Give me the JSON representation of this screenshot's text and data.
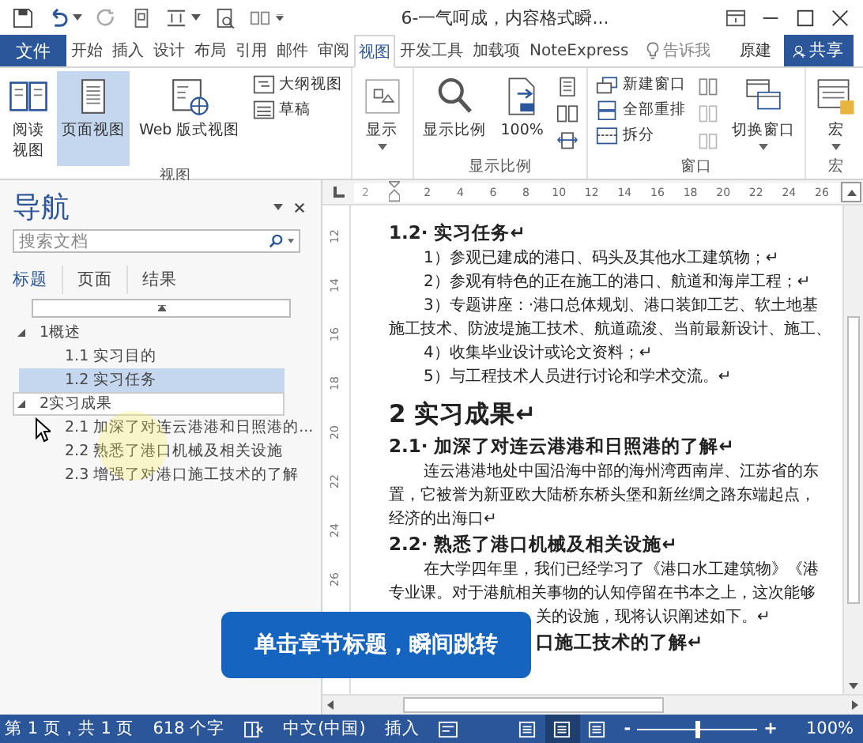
{
  "title_bar": {
    "title": "6-一气呵成，内容格式瞬..."
  },
  "ribbon_tabs": [
    {
      "label": "文件",
      "kind": "file"
    },
    {
      "label": "开始",
      "kind": "tab",
      "selected": false
    },
    {
      "label": "插入",
      "kind": "tab",
      "selected": false
    },
    {
      "label": "设计",
      "kind": "tab",
      "selected": false
    },
    {
      "label": "布局",
      "kind": "tab",
      "selected": false
    },
    {
      "label": "引用",
      "kind": "tab",
      "selected": false
    },
    {
      "label": "邮件",
      "kind": "tab",
      "selected": false
    },
    {
      "label": "审阅",
      "kind": "tab",
      "selected": false
    },
    {
      "label": "视图",
      "kind": "tab",
      "selected": true
    },
    {
      "label": "开发工具",
      "kind": "tab",
      "selected": false
    },
    {
      "label": "加载项",
      "kind": "tab",
      "selected": false
    },
    {
      "label": "NoteExpress",
      "kind": "tab",
      "selected": false
    }
  ],
  "tell_me": "告诉我",
  "user": "原建",
  "share": "共享",
  "ribbon_groups": [
    {
      "label": "视图",
      "buttons": [
        {
          "label": "阅读视图",
          "kind": "large",
          "selected": false
        },
        {
          "label": "页面视图",
          "kind": "large",
          "selected": true
        },
        {
          "label": "Web 版式视图",
          "kind": "large",
          "selected": false
        },
        {
          "label": "大纲视图",
          "kind": "small",
          "selected": false
        },
        {
          "label": "草稿",
          "kind": "small",
          "selected": false
        }
      ]
    },
    {
      "buttons": [
        {
          "label": "显示",
          "kind": "dropdown"
        }
      ]
    },
    {
      "label": "显示比例",
      "buttons": [
        {
          "label": "显示比例",
          "kind": "large"
        },
        {
          "label": "100%",
          "kind": "large"
        },
        {
          "kind": "icon"
        },
        {
          "kind": "icon"
        },
        {
          "kind": "icon"
        }
      ]
    },
    {
      "label": "窗口",
      "buttons": [
        {
          "label": "新建窗口",
          "kind": "small"
        },
        {
          "label": "全部重排",
          "kind": "small"
        },
        {
          "label": "拆分",
          "kind": "small"
        },
        {
          "kind": "icon"
        },
        {
          "kind": "icon"
        },
        {
          "kind": "icon"
        },
        {
          "label": "切换窗口",
          "kind": "dropdown"
        }
      ]
    },
    {
      "label": "宏",
      "buttons": [
        {
          "label": "宏",
          "kind": "dropdown"
        }
      ]
    }
  ],
  "navigation": {
    "title": "导航",
    "search": {
      "placeholder": "搜索文档"
    },
    "tabs": [
      {
        "label": "标题",
        "selected": true
      },
      {
        "label": "页面",
        "selected": false
      },
      {
        "label": "结果",
        "selected": false
      }
    ],
    "tree": [
      {
        "label": "1概述",
        "expanded": true,
        "selected": false,
        "hovered": false,
        "children": [
          {
            "label": "1.1 实习目的",
            "selected": false,
            "hovered": false
          },
          {
            "label": "1.2 实习任务",
            "selected": true,
            "hovered": false
          }
        ]
      },
      {
        "label": "2实习成果",
        "expanded": true,
        "selected": false,
        "hovered": true,
        "children": [
          {
            "label": "2.1 加深了对连云港港和日照港的...",
            "selected": false,
            "hovered": false
          },
          {
            "label": "2.2 熟悉了港口机械及相关设施",
            "selected": false,
            "hovered": false
          },
          {
            "label": "2.3 增强了对港口施工技术的了解",
            "selected": false,
            "hovered": false
          }
        ]
      }
    ]
  },
  "ruler": {
    "horizontal": [
      "2",
      "2",
      "4",
      "6",
      "8",
      "10",
      "12",
      "14",
      "16",
      "18",
      "20",
      "22",
      "24",
      "26"
    ],
    "vertical": [
      "12",
      "14",
      "16",
      "18",
      "20",
      "22",
      "24",
      "26"
    ]
  },
  "document": [
    {
      "kind": "h3",
      "text": "1.2· 实习任务↵"
    },
    {
      "kind": "indent",
      "text": "1）参观已建成的港口、码头及其他水工建筑物；↵"
    },
    {
      "kind": "indent",
      "text": "2）参观有特色的正在施工的港口、航道和海岸工程；↵"
    },
    {
      "kind": "indent",
      "text": "3）专题讲座：·港口总体规划、港口装卸工艺、软土地基"
    },
    {
      "kind": "body",
      "text": "施工技术、防波堤施工技术、航道疏浚、当前最新设计、施工、"
    },
    {
      "kind": "indent",
      "text": "4）收集毕业设计或论文资料；↵"
    },
    {
      "kind": "indent",
      "text": "5）与工程技术人员进行讨论和学术交流。↵"
    },
    {
      "kind": "h2",
      "text": "2 实习成果↵"
    },
    {
      "kind": "h3",
      "text": "2.1· 加深了对连云港港和日照港的了解↵"
    },
    {
      "kind": "indent",
      "text": "连云港港地处中国沿海中部的海州湾西南岸、江苏省的东"
    },
    {
      "kind": "body",
      "text": "置，它被誉为新亚欧大陆桥东桥头堡和新丝绸之路东端起点，"
    },
    {
      "kind": "body",
      "text": "经济的出海口↵"
    },
    {
      "kind": "h3",
      "text": "2.2· 熟悉了港口机械及相关设施↵"
    },
    {
      "kind": "indent",
      "text": "在大学四年里，我们已经学习了《港口水工建筑物》《港"
    },
    {
      "kind": "body",
      "text": "专业课。对于港航相关事物的认知停留在书本之上，这次能够"
    },
    {
      "kind": "covered-body",
      "text": "关的设施，现将认识阐述如下。↵"
    },
    {
      "kind": "covered-h3",
      "text": "口施工技术的了解↵"
    }
  ],
  "callout": "单击章节标题，瞬间跳转",
  "status_bar": {
    "page": "第 1 页，共 1 页",
    "words": "618 个字",
    "language": "中文(中国)",
    "mode": "插入",
    "views": [
      {
        "selected": false
      },
      {
        "selected": true
      },
      {
        "selected": false
      }
    ],
    "zoom_minus": "-",
    "zoom_plus": "+",
    "zoom": {
      "level": 0.5
    },
    "zoom_value": "100%"
  }
}
